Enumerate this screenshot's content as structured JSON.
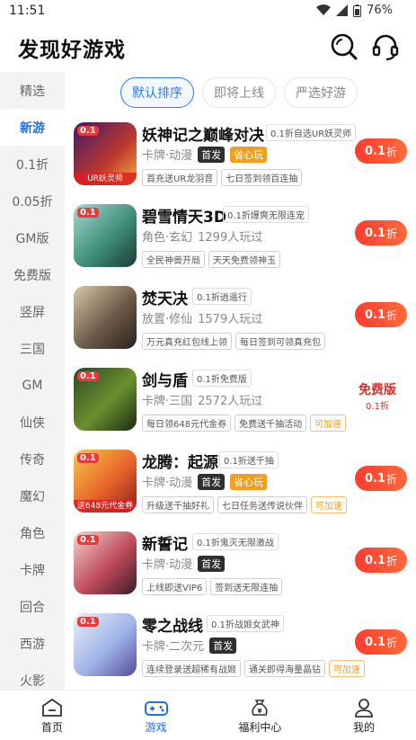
{
  "status": {
    "time": "11:51",
    "battery": "76%"
  },
  "header": {
    "title": "发现好游戏"
  },
  "sidebar": {
    "items": [
      {
        "label": "精选"
      },
      {
        "label": "新游"
      },
      {
        "label": "0.1折"
      },
      {
        "label": "0.05折"
      },
      {
        "label": "GM版"
      },
      {
        "label": "免费版"
      },
      {
        "label": "竖屏"
      },
      {
        "label": "三国"
      },
      {
        "label": "GM"
      },
      {
        "label": "仙侠"
      },
      {
        "label": "传奇"
      },
      {
        "label": "魔幻"
      },
      {
        "label": "角色"
      },
      {
        "label": "卡牌"
      },
      {
        "label": "回合"
      },
      {
        "label": "西游"
      },
      {
        "label": "火影"
      }
    ],
    "active": "新游"
  },
  "tabs": [
    {
      "label": "默认排序"
    },
    {
      "label": "即将上线"
    },
    {
      "label": "严选好游"
    }
  ],
  "games": [
    {
      "name": "妖神记之巅峰对决",
      "promo": "0.1折自选UR妖灵师",
      "meta": "卡牌·动漫",
      "badge_first": "首发",
      "badge_worry": "省心玩",
      "icon_corner": "0.1",
      "icon_band": "UR妖灵师",
      "tags": [
        "首充送UR龙羽音",
        "七日签到领百连抽"
      ],
      "price": "0.1",
      "price_unit": "折"
    },
    {
      "name": "碧雪情天3D",
      "promo": "0.1折爆爽无限连宠",
      "meta": "角色·玄幻",
      "players": "1299人玩过",
      "icon_corner": "0.1",
      "tags": [
        "全民神兽开局",
        "天天免费领神玉"
      ],
      "price": "0.1",
      "price_unit": "折"
    },
    {
      "name": "焚天决",
      "promo": "0.1折逍遥行",
      "meta": "放置·修仙",
      "players": "1579人玩过",
      "tags": [
        "万元真充红包线上领",
        "每日签到可领真充包"
      ],
      "price": "0.1",
      "price_unit": "折"
    },
    {
      "name": "剑与盾",
      "promo": "0.1折免费版",
      "meta": "卡牌·三国",
      "players": "2572人玩过",
      "icon_corner": "0.1",
      "tags": [
        "每日领648元代金券",
        "免费送千抽活动"
      ],
      "tag_speed": "可加速",
      "free_badge": "免费版",
      "free_badge_sub": "0.1折"
    },
    {
      "name": "龙腾：起源",
      "promo": "0.1折送千抽",
      "meta": "卡牌·动漫",
      "badge_first": "首发",
      "badge_worry": "省心玩",
      "icon_corner": "0.1",
      "icon_band": "送648元代金券",
      "tags": [
        "升级送千抽好礼",
        "七日任务送传说伙伴"
      ],
      "tag_speed": "可加速",
      "price": "0.1",
      "price_unit": "折"
    },
    {
      "name": "新誓记",
      "promo": "0.1折鬼灭无限激战",
      "meta": "卡牌·动漫",
      "badge_first": "首发",
      "icon_corner": "0.1",
      "tags": [
        "上线即送VIP6",
        "签到送无限连抽"
      ],
      "price": "0.1",
      "price_unit": "折"
    },
    {
      "name": "零之战线",
      "promo": "0.1折战姬女武神",
      "meta": "卡牌·二次元",
      "badge_first": "首发",
      "icon_corner": "0.1",
      "tags": [
        "连续登录送超稀有战姬",
        "通关即得海量晶钻"
      ],
      "tag_speed": "可加速",
      "price": "0.1",
      "price_unit": "折"
    }
  ],
  "bottom_nav": [
    {
      "label": "首页"
    },
    {
      "label": "游戏"
    },
    {
      "label": "福利中心"
    },
    {
      "label": "我的"
    }
  ],
  "colors": {
    "accent": "#1f6fe5",
    "price": "#ff3b2f",
    "sidebar_bg": "#f2f3f5"
  }
}
